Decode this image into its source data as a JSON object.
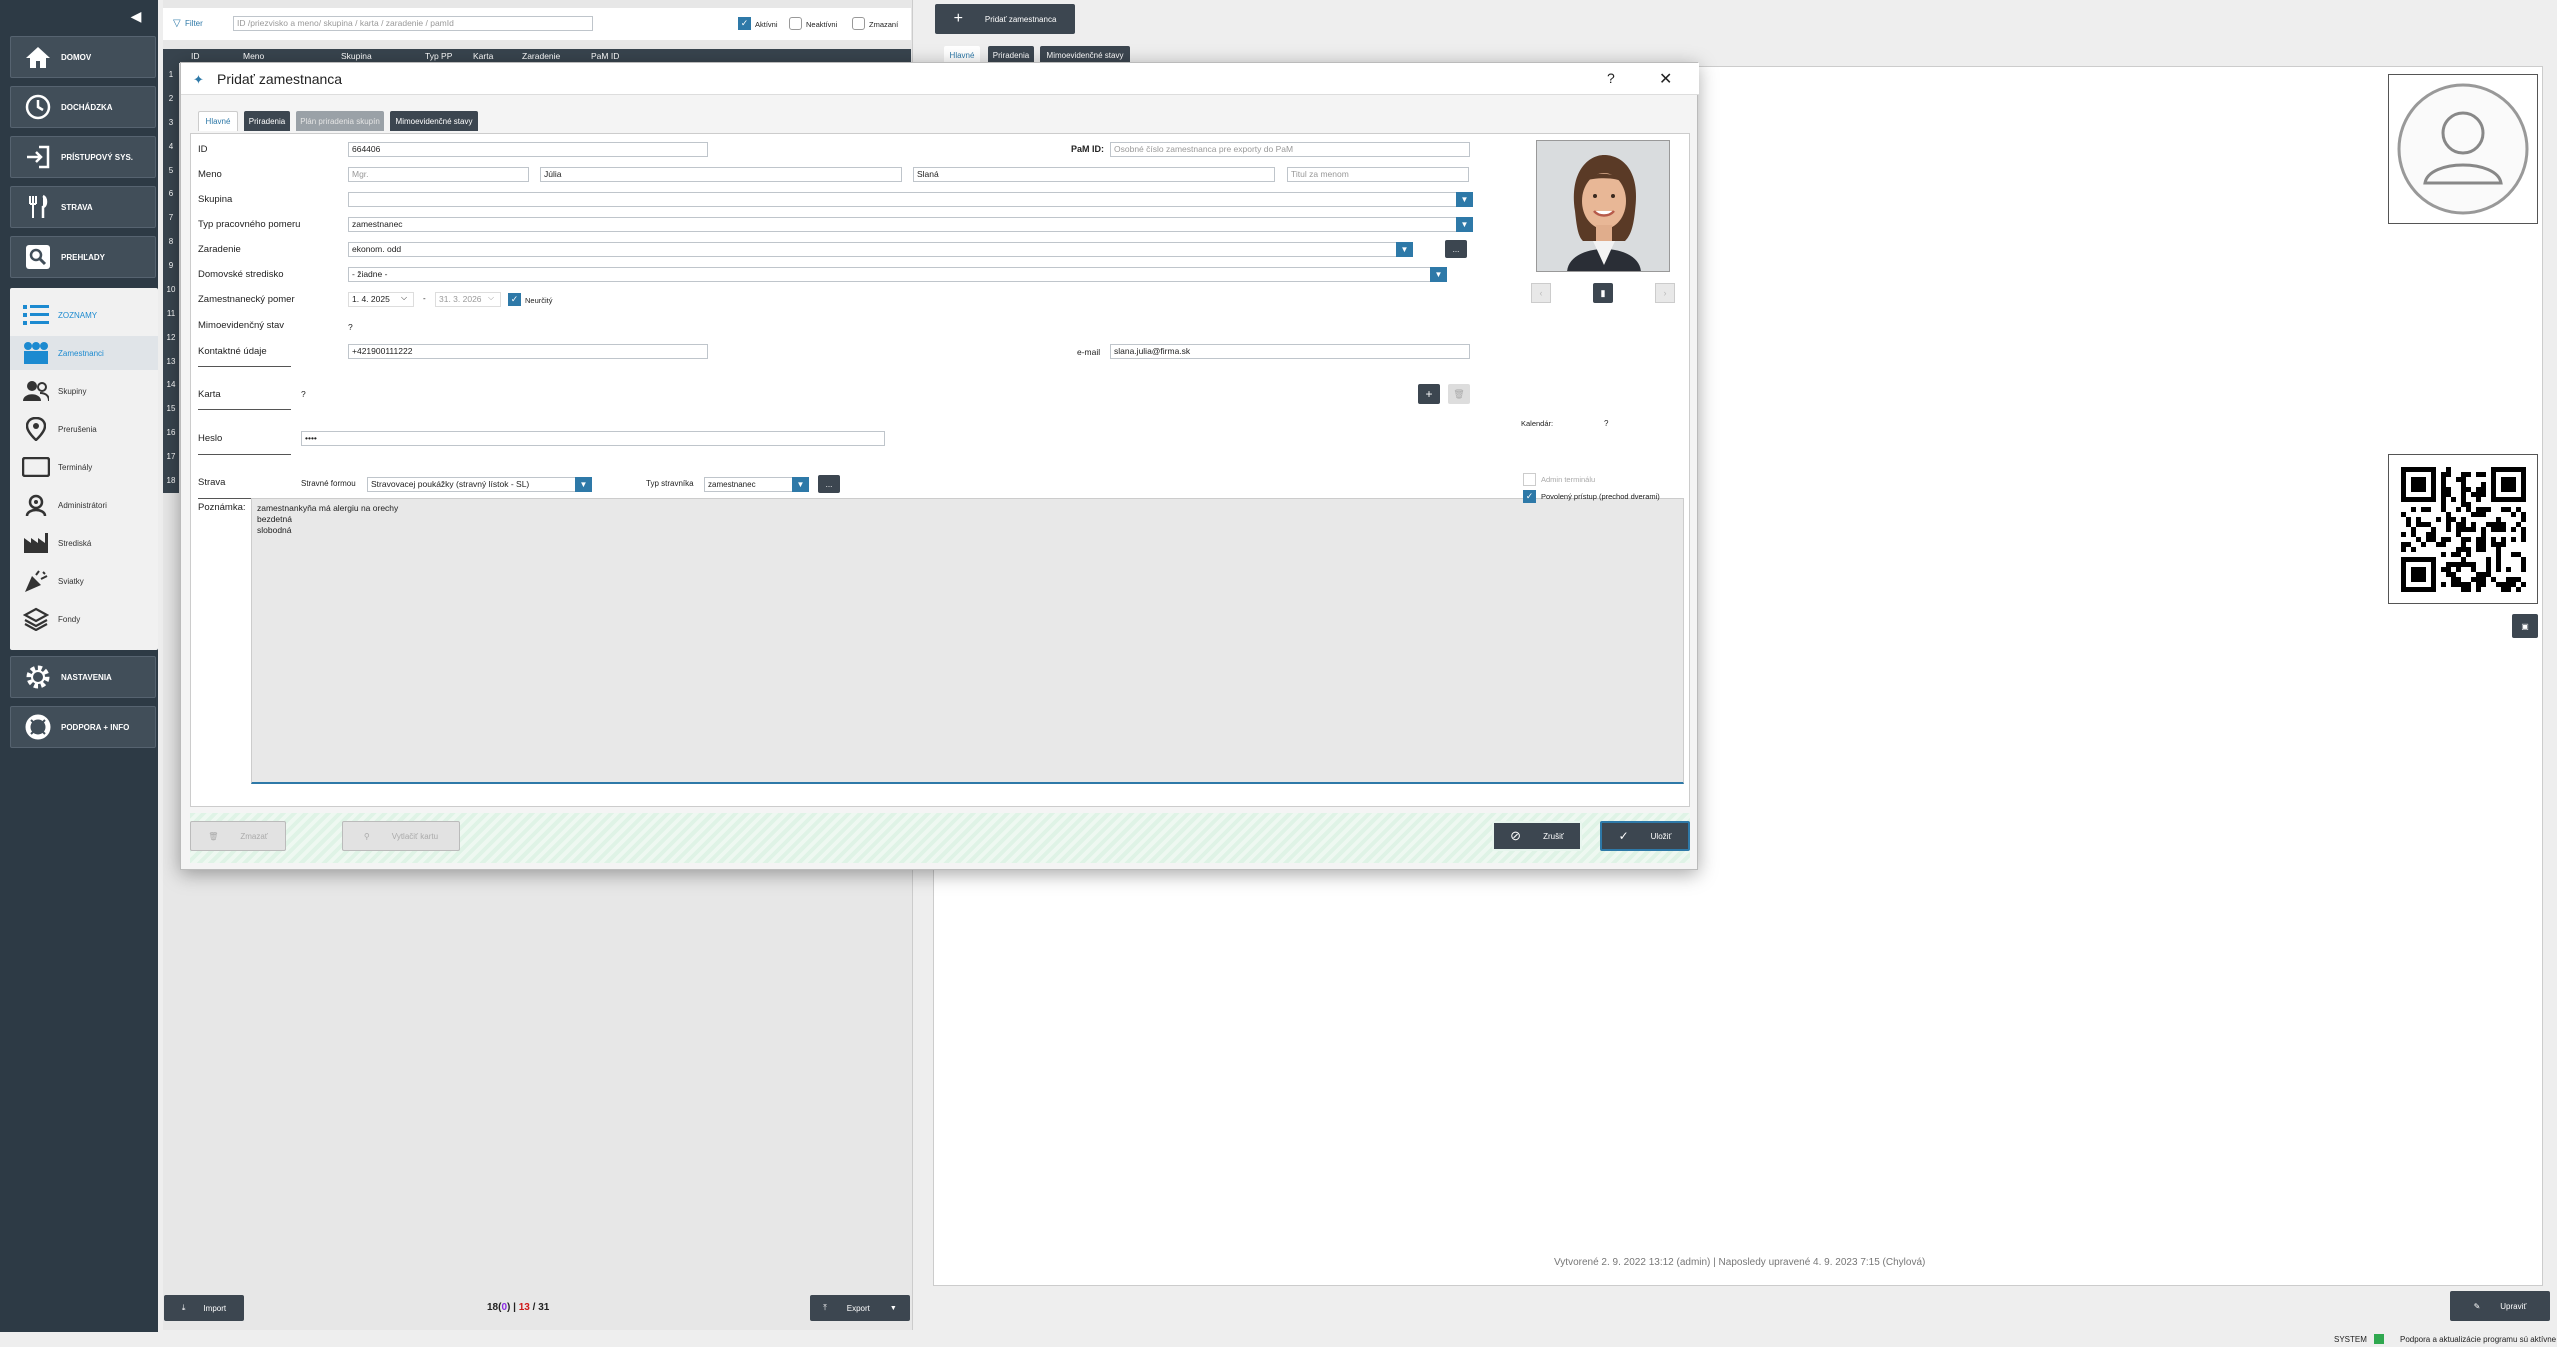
{
  "sidebar": {
    "home": "DOMOV",
    "attendance": "DOCHÁDZKA",
    "access": "PRÍSTUPOVÝ SYS.",
    "food": "STRAVA",
    "overview": "PREHĽADY",
    "lists": "ZOZNAMY",
    "employees": "Zamestnanci",
    "groups": "Skupiny",
    "interruptions": "Prerušenia",
    "terminals": "Terminály",
    "administrators": "Administrátori",
    "centers": "Strediská",
    "holidays": "Sviatky",
    "funds": "Fondy",
    "settings": "NASTAVENIA",
    "support": "PODPORA + INFO"
  },
  "list": {
    "filter_label": "Filter",
    "filter_placeholder": "ID /priezvisko a meno/ skupina / karta / zaradenie / pamId",
    "active_label": "Aktívni",
    "inactive_label": "Neaktívni",
    "deleted_label": "Zmazaní",
    "columns": [
      "ID",
      "Meno",
      "Skupina",
      "Typ PP",
      "Karta",
      "Zaradenie",
      "PaM ID"
    ],
    "row_numbers": [
      "1",
      "2",
      "3",
      "4",
      "5",
      "6",
      "7",
      "8",
      "9",
      "10",
      "11",
      "12",
      "13",
      "14",
      "15",
      "16",
      "17",
      "18"
    ],
    "import_label": "Import",
    "export_label": "Export",
    "count_total_visible": "18",
    "count_open": "(",
    "count_zero": "0",
    "count_close": ")",
    "count_sep1": "|",
    "count_red": "13",
    "count_sep2": "/",
    "count_all": "31"
  },
  "right": {
    "add_employee": "Pridať zamestnanca",
    "tabs": [
      "Hlavné",
      "Priradenia",
      "Mimoevidenčné stavy"
    ],
    "footer_info": "Vytvorené 2. 9. 2022 13:12 (admin) | Naposledy upravené 4. 9. 2023 7:15 (Chylová)",
    "edit_label": "Upraviť"
  },
  "modal": {
    "title": "Pridať zamestnanca",
    "help": "?",
    "close": "✕",
    "tabs": [
      "Hlavné",
      "Priradenia",
      "Plán priradenia skupín",
      "Mimoevidenčné stavy"
    ],
    "labels": {
      "id": "ID",
      "name": "Meno",
      "group": "Skupina",
      "contract_type": "Typ pracovného pomeru",
      "position": "Zaradenie",
      "home_center": "Domovské stredisko",
      "employment": "Zamestnanecký pomer",
      "special_state": "Mimoevidenčný stav",
      "contact": "Kontaktné údaje",
      "card": "Karta",
      "password": "Heslo",
      "food": "Strava",
      "note": "Poznámka:",
      "pam_id": "PaM ID:",
      "email": "e-mail",
      "food_form": "Stravné formou",
      "eater_type": "Typ stravníka",
      "calendar": "Kalendár:",
      "admin_terminal": "Admin terminálu",
      "allowed_access": "Povolený prístup (prechod dverami)",
      "indefinite": "Neurčitý"
    },
    "values": {
      "id": "664406",
      "pam_placeholder": "Osobné číslo zamestnanca pre exporty do PaM",
      "title_before": "Mgr.",
      "first_name": "Júlia",
      "last_name": "Slaná",
      "title_after_placeholder": "Titul za menom",
      "group": "",
      "contract_type": "zamestnanec",
      "position": "ekonom. odd",
      "home_center": "- žiadne -",
      "date_from": "1. 4. 2025",
      "date_dash": "-",
      "date_to": "31. 3. 2026",
      "special_state": "?",
      "phone": "+421900111222",
      "email": "slana.julia@firma.sk",
      "card": "?",
      "password": "••••",
      "food_form": "Stravovacej poukážky (stravný lístok - SL)",
      "eater_type": "zamestnanec",
      "calendar": "?",
      "note_lines": [
        "zamestnankyňa má alergiu na orechy",
        "bezdetná",
        "slobodná"
      ],
      "more": "...",
      "plus": "+"
    },
    "footer": {
      "delete": "Zmazať",
      "print_card": "Vytlačiť kartu",
      "cancel": "Zrušiť",
      "save": "Uložiť"
    }
  },
  "status": {
    "user": "SYSTEM",
    "message": "Podpora a aktualizácie programu sú aktívne"
  },
  "colors": {
    "sidebar_bg": "#2d3a45",
    "accent_blue": "#2e79a8",
    "active_blue": "#1c8ad0",
    "red_count": "#d11a1a",
    "purple_count": "#8a2be2"
  }
}
